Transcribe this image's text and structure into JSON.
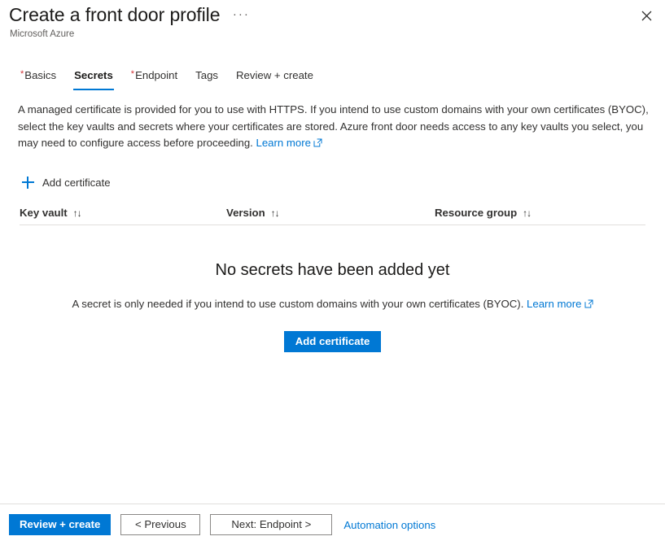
{
  "header": {
    "title": "Create a front door profile",
    "subtitle": "Microsoft Azure",
    "context_menu_label": "···",
    "close_label": "Close",
    "close_icon": "close-icon",
    "context_menu_icon": "ellipsis-icon"
  },
  "tabs": [
    {
      "label": "Basics",
      "required": true,
      "active": false
    },
    {
      "label": "Secrets",
      "required": false,
      "active": true
    },
    {
      "label": "Endpoint",
      "required": true,
      "active": false
    },
    {
      "label": "Tags",
      "required": false,
      "active": false
    },
    {
      "label": "Review + create",
      "required": false,
      "active": false
    }
  ],
  "description": {
    "text": "A managed certificate is provided for you to use with HTTPS. If you intend to use custom domains with your own certificates (BYOC), select the key vaults and secrets where your certificates are stored. Azure front door needs access to any key vaults you select, you may need to configure access before proceeding.",
    "link_label": "Learn more",
    "link_icon": "external-link-icon"
  },
  "command_bar": {
    "add_certificate_label": "Add certificate",
    "add_icon": "plus-icon"
  },
  "grid": {
    "columns": [
      {
        "label": "Key vault",
        "sort_icon": "↑↓"
      },
      {
        "label": "Version",
        "sort_icon": "↑↓"
      },
      {
        "label": "Resource group",
        "sort_icon": "↑↓"
      }
    ],
    "rows": []
  },
  "empty_state": {
    "title": "No secrets have been added yet",
    "subtitle": "A secret is only needed if you intend to use custom domains with your own certificates (BYOC).",
    "link_label": "Learn more",
    "link_icon": "external-link-icon",
    "button_label": "Add certificate"
  },
  "footer": {
    "review_create_label": "Review + create",
    "previous_label": "< Previous",
    "next_label": "Next: Endpoint >",
    "automation_label": "Automation options"
  },
  "colors": {
    "accent": "#0078d4",
    "required_asterisk": "#d13438",
    "text": "#323130",
    "divider": "#e1dfdd",
    "background": "#ffffff"
  }
}
